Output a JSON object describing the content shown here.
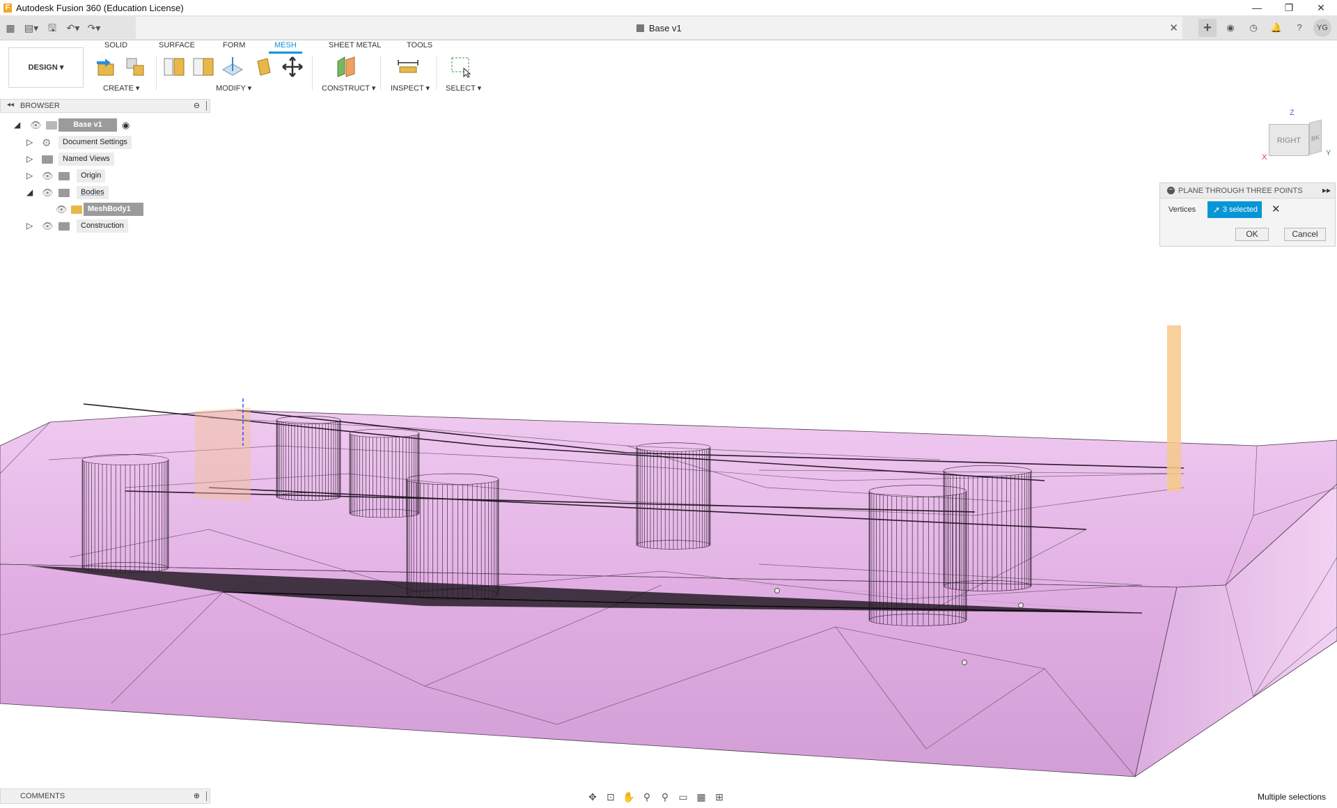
{
  "window": {
    "title": "Autodesk Fusion 360 (Education License)",
    "app_letter": "F"
  },
  "window_controls": {
    "minimize": "—",
    "restore": "❐",
    "close": "✕"
  },
  "quick_access": [
    "▦",
    "▤▾",
    "🖫",
    "↶▾",
    "↷▾"
  ],
  "document_tab": {
    "name": "Base v1",
    "close": "✕"
  },
  "header_right": {
    "add": "+",
    "avatar": "YG"
  },
  "workspace": {
    "label": "DESIGN ▾"
  },
  "toolbar_tabs": [
    "SOLID",
    "SURFACE",
    "FORM",
    "MESH",
    "SHEET METAL",
    "TOOLS"
  ],
  "active_tab": "MESH",
  "toolbar_groups": [
    "CREATE ▾",
    "MODIFY ▾",
    "CONSTRUCT ▾",
    "INSPECT ▾",
    "SELECT ▾"
  ],
  "browser": {
    "title": "BROWSER",
    "items": [
      {
        "label": "Base v1"
      },
      {
        "label": "Document Settings"
      },
      {
        "label": "Named Views"
      },
      {
        "label": "Origin"
      },
      {
        "label": "Bodies"
      },
      {
        "label": "MeshBody1"
      },
      {
        "label": "Construction"
      }
    ]
  },
  "viewcube": {
    "face": "RIGHT",
    "side": "BK",
    "x": "X",
    "y": "Y",
    "z": "Z"
  },
  "dialog": {
    "title": "PLANE THROUGH THREE POINTS",
    "vertices_label": "Vertices",
    "selection": "3 selected",
    "ok": "OK",
    "cancel": "Cancel"
  },
  "comments": {
    "title": "COMMENTS"
  },
  "status": {
    "text": "Multiple selections"
  },
  "colors": {
    "accent": "#0696d7",
    "mesh_fill": "#e4b4e6",
    "mesh_edge": "#3a2a3a",
    "construction_plane": "#f7c98a"
  }
}
